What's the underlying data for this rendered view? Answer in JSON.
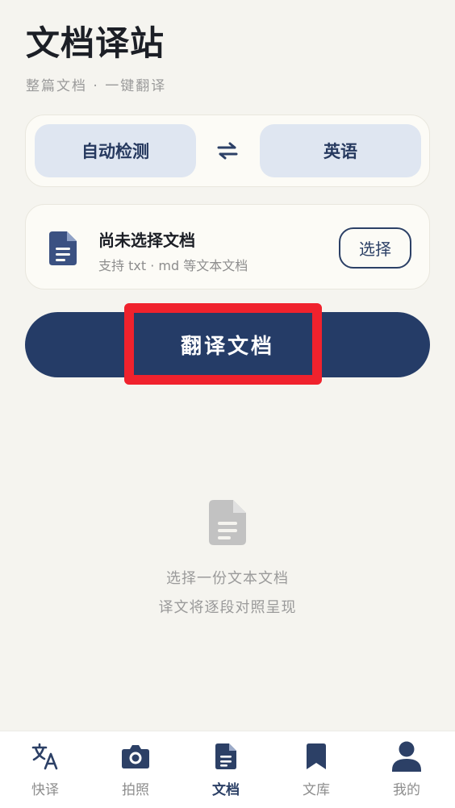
{
  "header": {
    "title": "文档译站",
    "subtitle": "整篇文档 · 一键翻译"
  },
  "language": {
    "source": "自动检测",
    "target": "英语",
    "swap_icon": "swap-arrows-icon"
  },
  "document": {
    "icon": "document-icon",
    "title": "尚未选择文档",
    "hint": "支持 txt · md 等文本文档",
    "select_label": "选择"
  },
  "translate_label": "翻译文档",
  "empty_state": {
    "icon": "document-icon",
    "line1": "选择一份文本文档",
    "line2": "译文将逐段对照呈现"
  },
  "tabs": [
    {
      "label": "快译",
      "icon": "translate-icon",
      "active": false
    },
    {
      "label": "拍照",
      "icon": "camera-icon",
      "active": false
    },
    {
      "label": "文档",
      "icon": "document-icon",
      "active": true
    },
    {
      "label": "文库",
      "icon": "bookmark-icon",
      "active": false
    },
    {
      "label": "我的",
      "icon": "person-icon",
      "active": false
    }
  ],
  "colors": {
    "primary": "#253c67",
    "accent_light": "#dfe6f1",
    "background": "#f5f4ef",
    "highlight": "#f0222d"
  }
}
